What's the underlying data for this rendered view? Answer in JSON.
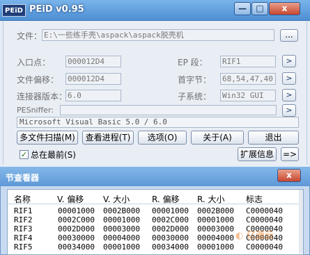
{
  "window": {
    "icon_text": "PEiD",
    "title": "PEiD v0.95",
    "min": "—",
    "max": "□",
    "close": "x"
  },
  "file": {
    "label": "文件：",
    "value": "E:\\一些练手壳\\aspack\\aspack脱壳机",
    "browse": "..."
  },
  "fields": {
    "entry_point": {
      "label": "入口点：",
      "value": "000012D4"
    },
    "file_offset": {
      "label": "文件偏移：",
      "value": "000012D4"
    },
    "linker_version": {
      "label": "连接器版本：",
      "value": "6.0"
    },
    "ep_section": {
      "label": "EP 段：",
      "value": "RIF1"
    },
    "first_bytes": {
      "label": "首字节：",
      "value": "68,54,47,40"
    },
    "subsystem": {
      "label": "子系统：",
      "value": "Win32 GUI"
    }
  },
  "arrow": ">",
  "pesniffer": {
    "label": "PESniffer:",
    "value": ""
  },
  "detection": "Microsoft Visual Basic 5.0 / 6.0",
  "buttons": {
    "multi_scan": "多文件扫描(M)",
    "task_viewer": "查看进程(T)",
    "options": "选项(O)",
    "about": "关于(A)",
    "exit": "退出",
    "extensions": "扩展信息",
    "arrow_right": "=>"
  },
  "always_on_top": {
    "label": "总在最前(S)",
    "checked": true,
    "mark": "✓"
  },
  "sections": {
    "title": "节查看器",
    "close": "x",
    "columns": [
      "名称",
      "V. 偏移",
      "V. 大小",
      "R. 偏移",
      "R. 大小",
      "标志"
    ],
    "rows": [
      [
        "RIF1",
        "00001000",
        "0002B000",
        "00001000",
        "0002B000",
        "C0000040"
      ],
      [
        "RIF2",
        "0002C000",
        "00001000",
        "0002C000",
        "00001000",
        "C0000040"
      ],
      [
        "RIF3",
        "0002D000",
        "00003000",
        "0002D000",
        "00003000",
        "C0000040"
      ],
      [
        "RIF4",
        "00030000",
        "00004000",
        "00030000",
        "00004000",
        "C0000040"
      ],
      [
        "RIF5",
        "00034000",
        "00001000",
        "00034000",
        "00001000",
        "C0000040"
      ]
    ]
  },
  "watermark": "亿速云"
}
